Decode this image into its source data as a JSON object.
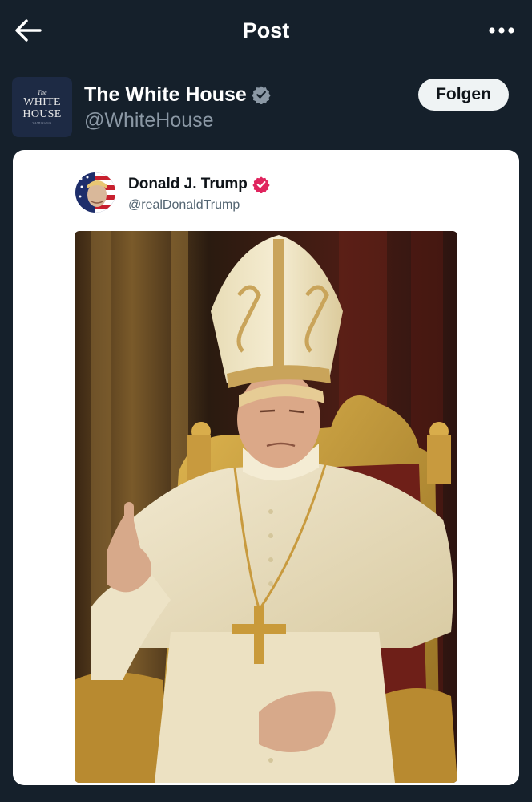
{
  "header": {
    "title": "Post",
    "back_icon": "arrow-left-icon",
    "more_icon": "more-horizontal-icon"
  },
  "account": {
    "name": "The White House",
    "handle": "@WhiteHouse",
    "follow_label": "Folgen",
    "avatar_text": {
      "line1": "The",
      "line2": "WHITE",
      "line3": "HOUSE",
      "line4": "WASHINGTON"
    },
    "verified_icon": "verified-badge-icon"
  },
  "embedded_post": {
    "author_name": "Donald J. Trump",
    "author_handle": "@realDonaldTrump",
    "verified_icon": "verified-badge-icon",
    "image_description_icon": "post-image"
  },
  "colors": {
    "background": "#15202b",
    "card": "#ffffff",
    "verified_gray": "#8b98a5",
    "verified_pink": "#e0245e",
    "follow_button_bg": "#eff3f4"
  }
}
